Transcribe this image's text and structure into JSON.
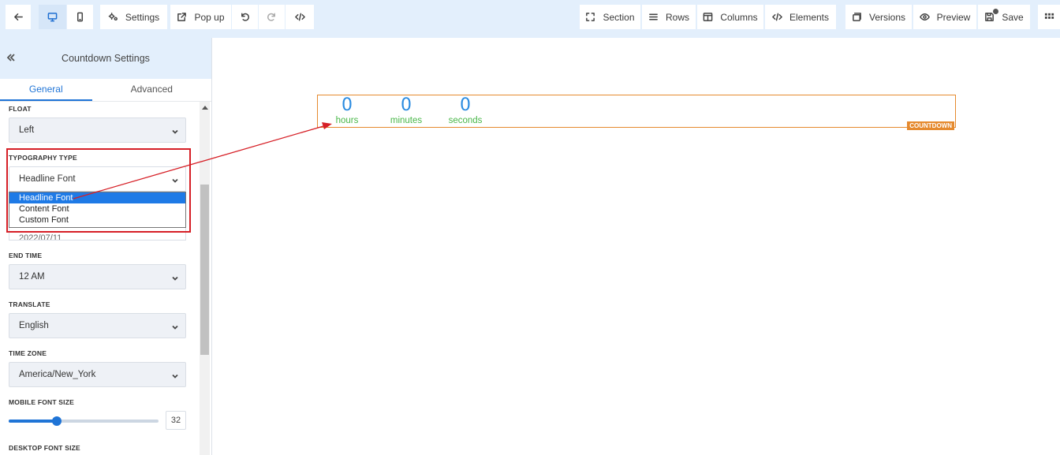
{
  "toolbar": {
    "settings_label": "Settings",
    "popup_label": "Pop up",
    "section_label": "Section",
    "rows_label": "Rows",
    "columns_label": "Columns",
    "elements_label": "Elements",
    "versions_label": "Versions",
    "preview_label": "Preview",
    "save_label": "Save"
  },
  "panel": {
    "title": "Countdown Settings",
    "tabs": [
      {
        "label": "General",
        "active": true
      },
      {
        "label": "Advanced",
        "active": false
      }
    ],
    "fields": {
      "float": {
        "label": "FLOAT",
        "value": "Left"
      },
      "typography": {
        "label": "TYPOGRAPHY TYPE",
        "value": "Headline Font",
        "options": [
          "Headline Font",
          "Content Font",
          "Custom Font"
        ],
        "selected_index": 0
      },
      "end_date_partial": "2022/07/11",
      "end_time": {
        "label": "END TIME",
        "value": "12 AM"
      },
      "translate": {
        "label": "TRANSLATE",
        "value": "English"
      },
      "time_zone": {
        "label": "TIME ZONE",
        "value": "America/New_York"
      },
      "mobile_font_size": {
        "label": "MOBILE FONT SIZE",
        "value": "32",
        "fraction": 0.32
      },
      "desktop_font_size": {
        "label": "DESKTOP FONT SIZE"
      }
    }
  },
  "countdown": {
    "units": [
      {
        "number": "0",
        "label": "hours"
      },
      {
        "number": "0",
        "label": "minutes"
      },
      {
        "number": "0",
        "label": "seconds"
      }
    ],
    "badge": "COUNTDOWN"
  },
  "colors": {
    "accent": "#1f74d6",
    "countdown_border": "#e58a2f",
    "number": "#2a8be0",
    "unit_label": "#48b748",
    "annotation": "#d61f26"
  }
}
